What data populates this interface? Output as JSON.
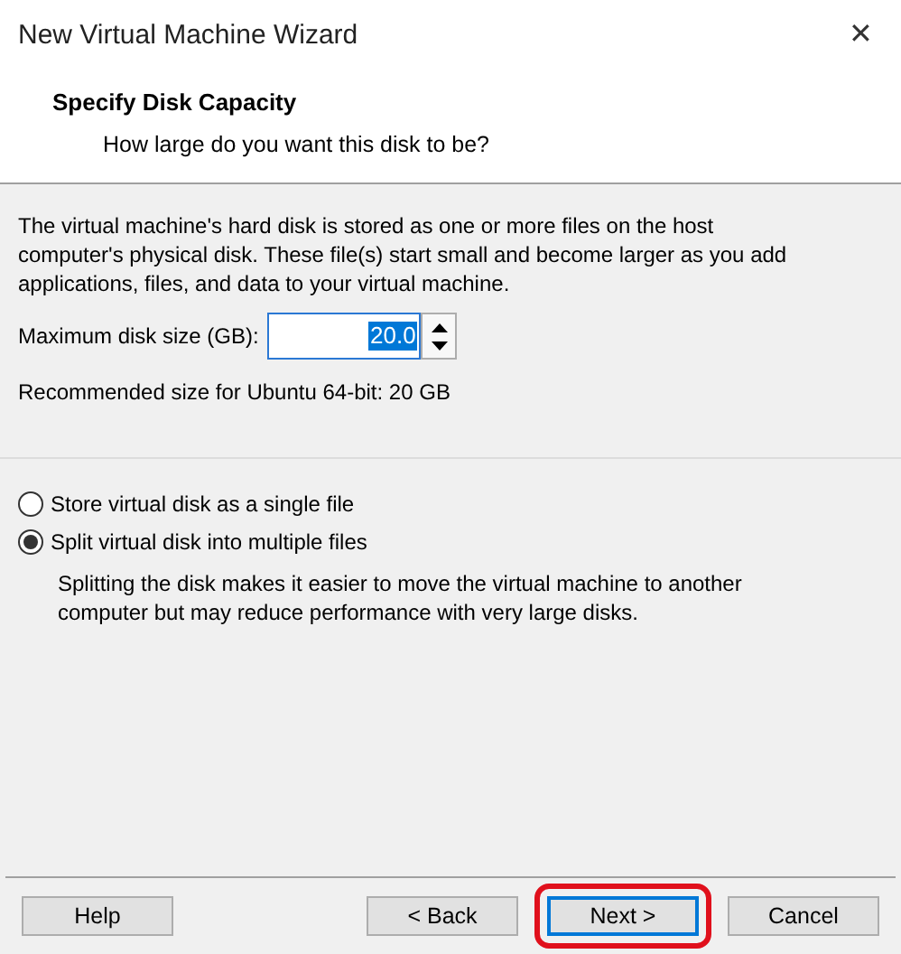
{
  "window": {
    "title": "New Virtual Machine Wizard",
    "close": "✕"
  },
  "header": {
    "title": "Specify Disk Capacity",
    "subtitle": "How large do you want this disk to be?"
  },
  "description": "The virtual machine's hard disk is stored as one or more files on the host computer's physical disk. These file(s) start small and become larger as you add applications, files, and data to your virtual machine.",
  "disk_size": {
    "label": "Maximum disk size (GB):",
    "value": "20.0",
    "value_highlighted": true
  },
  "recommended": "Recommended size for Ubuntu 64-bit: 20 GB",
  "options": [
    {
      "label": "Store virtual disk as a single file",
      "selected": false
    },
    {
      "label": "Split virtual disk into multiple files",
      "selected": true
    }
  ],
  "option_note": "Splitting the disk makes it easier to move the virtual machine to another computer but may reduce performance with very large disks.",
  "buttons": [
    {
      "label": "Help",
      "default": false,
      "highlighted": false
    },
    {
      "label": "< Back",
      "default": false,
      "highlighted": false
    },
    {
      "label": "Next >",
      "default": true,
      "highlighted": true
    },
    {
      "label": "Cancel",
      "default": false,
      "highlighted": false
    }
  ]
}
